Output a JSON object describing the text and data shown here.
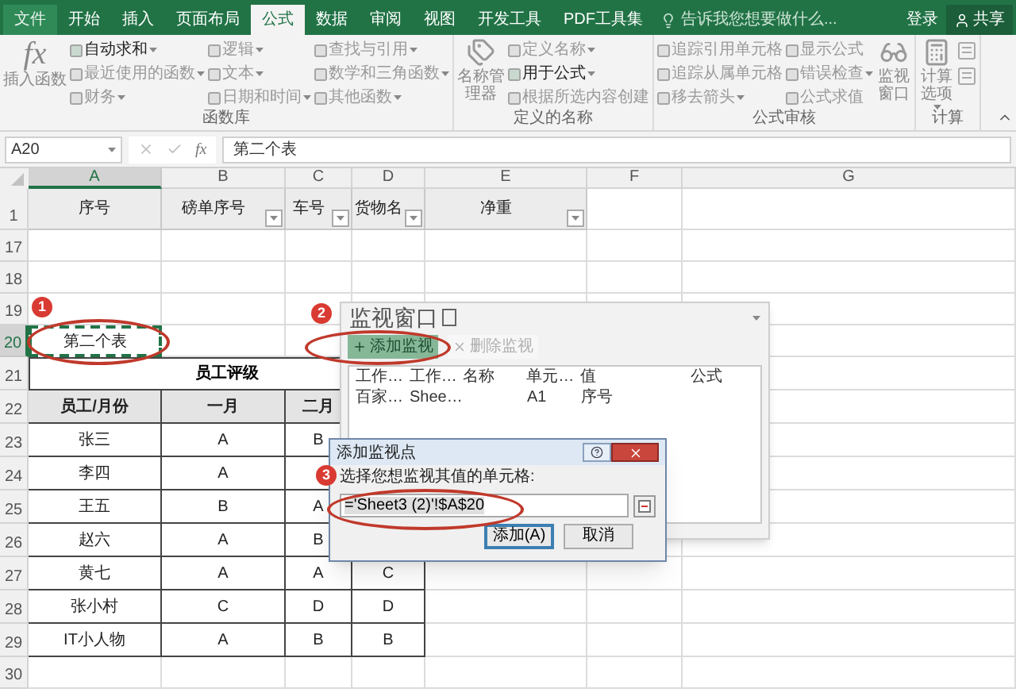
{
  "tabs": [
    {
      "label": "文件",
      "selected": false
    },
    {
      "label": "开始",
      "selected": false
    },
    {
      "label": "插入",
      "selected": false
    },
    {
      "label": "页面布局",
      "selected": false
    },
    {
      "label": "公式",
      "selected": true
    },
    {
      "label": "数据",
      "selected": false
    },
    {
      "label": "审阅",
      "selected": false
    },
    {
      "label": "视图",
      "selected": false
    },
    {
      "label": "开发工具",
      "selected": false
    },
    {
      "label": "PDF工具集",
      "selected": false
    }
  ],
  "search": {
    "placeholder": "告诉我您想要做什么..."
  },
  "account": {
    "sign_in": "登录",
    "share": "共享"
  },
  "ribbon": [
    {
      "label": "函数库",
      "columns": [
        [
          {
            "label": "插入函数",
            "kind": "large",
            "icon_text": "fx",
            "dropdown": false,
            "disabled": true
          }
        ],
        [
          {
            "label": "自动求和",
            "kind": "small",
            "dropdown": true,
            "disabled": false
          },
          {
            "label": "最近使用的函数",
            "kind": "small",
            "dropdown": true,
            "disabled": true
          },
          {
            "label": "财务",
            "kind": "small",
            "dropdown": true,
            "disabled": true
          }
        ],
        [
          {
            "label": "逻辑",
            "kind": "small",
            "dropdown": true,
            "disabled": true
          },
          {
            "label": "文本",
            "kind": "small",
            "dropdown": true,
            "disabled": true
          },
          {
            "label": "日期和时间",
            "kind": "small",
            "dropdown": true,
            "disabled": true
          }
        ],
        [
          {
            "label": "查找与引用",
            "kind": "small",
            "dropdown": true,
            "disabled": true
          },
          {
            "label": "数学和三角函数",
            "kind": "small",
            "dropdown": true,
            "disabled": true
          },
          {
            "label": "其他函数",
            "kind": "small",
            "dropdown": true,
            "disabled": true
          }
        ]
      ]
    },
    {
      "label": "定义的名称",
      "columns": [
        [
          {
            "label": "名称管理器",
            "kind": "large",
            "dropdown": false,
            "disabled": true
          }
        ],
        [
          {
            "label": "定义名称",
            "kind": "small",
            "dropdown": true,
            "disabled": true
          },
          {
            "label": "用于公式",
            "kind": "small",
            "dropdown": true,
            "disabled": false
          },
          {
            "label": "根据所选内容创建",
            "kind": "small",
            "dropdown": false,
            "disabled": true
          }
        ]
      ]
    },
    {
      "label": "公式审核",
      "columns": [
        [
          {
            "label": "追踪引用单元格",
            "kind": "small",
            "dropdown": false,
            "disabled": true
          },
          {
            "label": "追踪从属单元格",
            "kind": "small",
            "dropdown": false,
            "disabled": true
          },
          {
            "label": "移去箭头",
            "kind": "small",
            "dropdown": true,
            "disabled": true
          }
        ],
        [
          {
            "label": "显示公式",
            "kind": "small",
            "dropdown": false,
            "disabled": true
          },
          {
            "label": "错误检查",
            "kind": "small",
            "dropdown": true,
            "disabled": true
          },
          {
            "label": "公式求值",
            "kind": "small",
            "dropdown": false,
            "disabled": true
          }
        ],
        [
          {
            "label": "监视窗口",
            "kind": "large",
            "dropdown": false,
            "disabled": true
          }
        ]
      ]
    },
    {
      "label": "计算",
      "columns": [
        [
          {
            "label": "计算选项",
            "kind": "large",
            "dropdown": true,
            "disabled": true
          }
        ],
        [
          {
            "kind": "icon"
          },
          {
            "kind": "icon"
          }
        ]
      ]
    }
  ],
  "formula_bar": {
    "name_box": "A20",
    "function_symbol": "fx",
    "value": "第二个表"
  },
  "sheet": {
    "columns": [
      {
        "label": "A",
        "selected": true
      },
      {
        "label": "B",
        "selected": false
      },
      {
        "label": "C",
        "selected": false
      },
      {
        "label": "D",
        "selected": false
      },
      {
        "label": "E",
        "selected": false
      },
      {
        "label": "F",
        "selected": false
      },
      {
        "label": "G",
        "selected": false
      }
    ],
    "rows": [
      {
        "num": "1",
        "kind": "header",
        "selected": false,
        "cells": [
          {
            "text": "序号",
            "filter": false
          },
          {
            "text": "磅单序号",
            "filter": true
          },
          {
            "text": "车号",
            "filter": true
          },
          {
            "text": "货物名",
            "filter": true
          },
          {
            "text": "净重",
            "filter": true
          }
        ]
      },
      {
        "num": "17",
        "kind": "blank",
        "selected": false
      },
      {
        "num": "18",
        "kind": "blank",
        "selected": false
      },
      {
        "num": "19",
        "kind": "blank",
        "selected": false
      },
      {
        "num": "20",
        "kind": "marquee",
        "selected": true,
        "cells": [
          {
            "text": "第二个表"
          }
        ]
      },
      {
        "num": "21",
        "kind": "title",
        "selected": false,
        "cells": [
          {
            "text": "员工评级"
          }
        ]
      },
      {
        "num": "22",
        "kind": "table_header",
        "selected": false,
        "cells": [
          {
            "text": "员工/月份"
          },
          {
            "text": "一月"
          },
          {
            "text": "二月"
          }
        ]
      },
      {
        "num": "23",
        "kind": "table_row",
        "selected": false,
        "cells": [
          {
            "text": "张三"
          },
          {
            "text": "A"
          },
          {
            "text": "B"
          }
        ]
      },
      {
        "num": "24",
        "kind": "table_row",
        "selected": false,
        "cells": [
          {
            "text": "李四"
          },
          {
            "text": "A"
          }
        ]
      },
      {
        "num": "25",
        "kind": "table_row",
        "selected": false,
        "cells": [
          {
            "text": "王五"
          },
          {
            "text": "B"
          },
          {
            "text": "A"
          }
        ]
      },
      {
        "num": "26",
        "kind": "table_row",
        "selected": false,
        "cells": [
          {
            "text": "赵六"
          },
          {
            "text": "A"
          },
          {
            "text": "B"
          }
        ]
      },
      {
        "num": "27",
        "kind": "table_row",
        "selected": false,
        "cells": [
          {
            "text": "黄七"
          },
          {
            "text": "A"
          },
          {
            "text": "A"
          },
          {
            "text": "C"
          }
        ]
      },
      {
        "num": "28",
        "kind": "table_row",
        "selected": false,
        "cells": [
          {
            "text": "张小村"
          },
          {
            "text": "C"
          },
          {
            "text": "D"
          },
          {
            "text": "D"
          }
        ]
      },
      {
        "num": "29",
        "kind": "table_row",
        "selected": false,
        "cells": [
          {
            "text": "IT小人物"
          },
          {
            "text": "A"
          },
          {
            "text": "B"
          },
          {
            "text": "B"
          }
        ]
      },
      {
        "num": "30",
        "kind": "blank",
        "selected": false
      }
    ]
  },
  "watch_window": {
    "title": "监视窗口",
    "buttons": [
      {
        "label": "添加监视",
        "highlighted": true,
        "disabled": false
      },
      {
        "label": "删除监视",
        "highlighted": false,
        "disabled": true
      }
    ],
    "columns": [
      "工作…",
      "工作…",
      "名称",
      "单元…",
      "值",
      "公式"
    ],
    "rows": [
      {
        "workbook": "百家…",
        "sheet": "Shee…",
        "cell": "A1",
        "value": "序号"
      }
    ]
  },
  "dialog": {
    "title": "添加监视点",
    "prompt": "选择您想监视其值的单元格:",
    "value": "='Sheet3 (2)'!$A$20",
    "buttons": [
      {
        "label": "添加(A)",
        "default": true
      },
      {
        "label": "取消",
        "default": false
      }
    ]
  },
  "markers": [
    "1",
    "2",
    "3"
  ]
}
